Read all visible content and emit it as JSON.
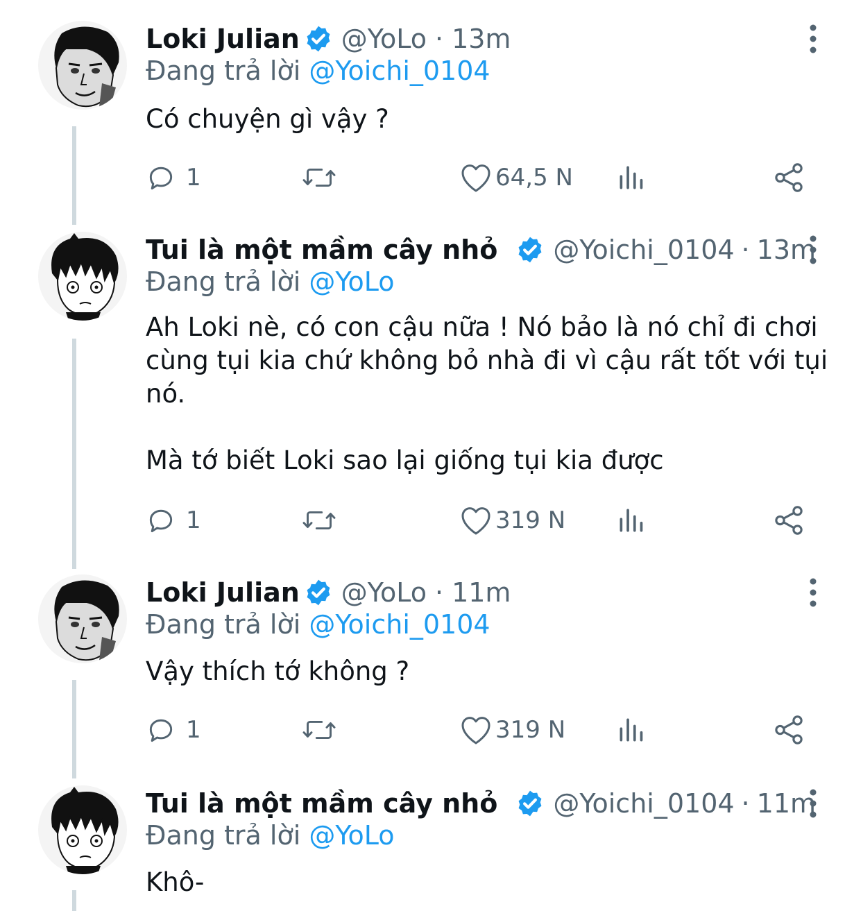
{
  "tweets": [
    {
      "author": "Loki Julian",
      "handle": "@YoLo",
      "time": "13m",
      "reply_prefix": "Đang trả lời",
      "reply_to": "@Yoichi_0104",
      "body": [
        "Có chuyện gì vậy ?"
      ],
      "replies": "1",
      "likes": "64,5 N"
    },
    {
      "author": "Tui là một mầm cây nhỏ",
      "handle": "@Yoichi_0104",
      "time": "13m",
      "reply_prefix": "Đang trả lời",
      "reply_to": "@YoLo",
      "body": [
        "Ah Loki nè, có con cậu nữa ! Nó bảo là nó chỉ đi chơi",
        "cùng tụi kia chứ không bỏ nhà đi vì cậu rất tốt với tụi",
        "nó.",
        "",
        "Mà tớ biết Loki sao lại giống tụi kia được"
      ],
      "replies": "1",
      "likes": "319 N"
    },
    {
      "author": "Loki Julian",
      "handle": "@YoLo",
      "time": "11m",
      "reply_prefix": "Đang trả lời",
      "reply_to": "@Yoichi_0104",
      "body": [
        "Vậy thích tớ không ?"
      ],
      "replies": "1",
      "likes": "319 N"
    },
    {
      "author": "Tui là một mầm cây nhỏ",
      "handle": "@Yoichi_0104",
      "time": "11m",
      "reply_prefix": "Đang trả lời",
      "reply_to": "@YoLo",
      "body": [
        "Khô-"
      ]
    }
  ],
  "separator": "·",
  "icons": {
    "reply": "reply-icon",
    "retweet": "retweet-icon",
    "like": "heart-icon",
    "views": "analytics-icon",
    "share": "share-icon",
    "more": "more-options-icon",
    "verified": "verified-badge-icon"
  },
  "colors": {
    "accent": "#1d9bf0",
    "text": "#0f1419",
    "muted": "#536471",
    "thread_line": "#cfd9de"
  }
}
